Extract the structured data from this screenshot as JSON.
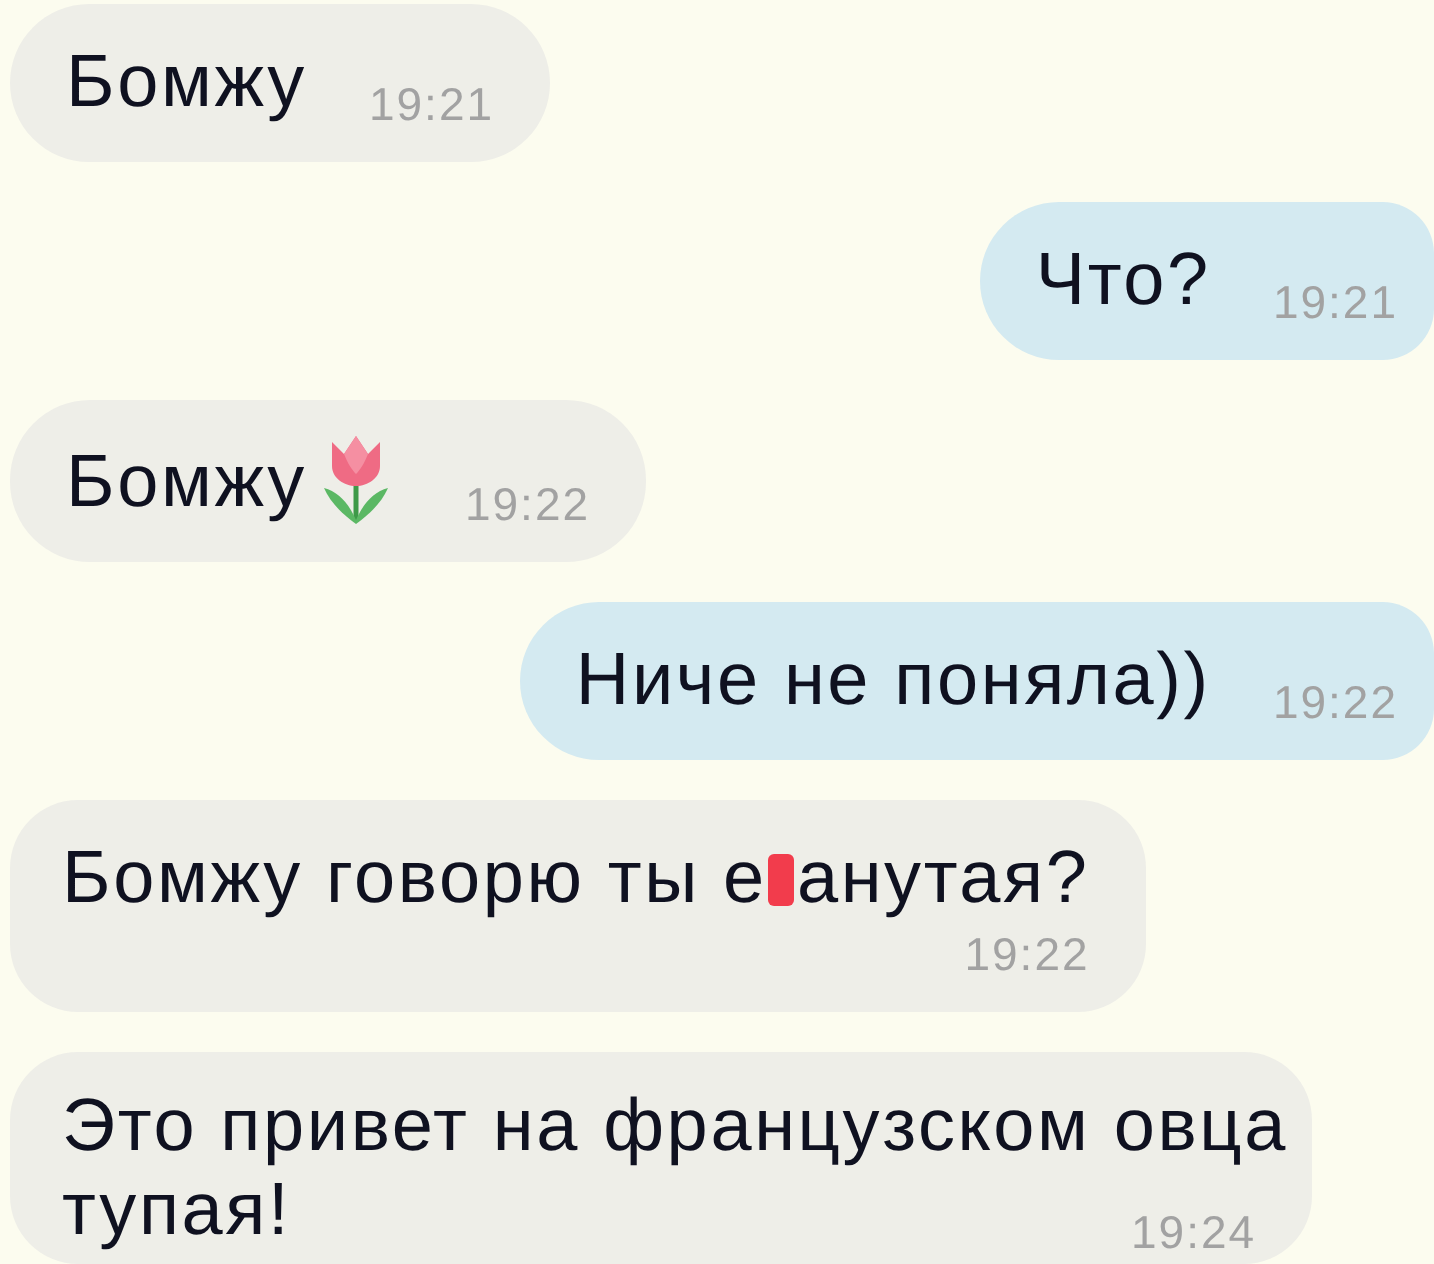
{
  "messages": [
    {
      "outgoing": false,
      "kind": "inline",
      "segments": [
        {
          "kind": "text",
          "text": "Бомжу"
        }
      ],
      "time": "19:21"
    },
    {
      "outgoing": true,
      "kind": "inline",
      "segments": [
        {
          "kind": "text",
          "text": "Что?"
        }
      ],
      "time": "19:21"
    },
    {
      "outgoing": false,
      "kind": "inline",
      "segments": [
        {
          "kind": "text",
          "text": "Бомжу"
        },
        {
          "kind": "emoji"
        }
      ],
      "time": "19:22"
    },
    {
      "outgoing": true,
      "kind": "inline",
      "segments": [
        {
          "kind": "text",
          "text": "Ниче не поняла))"
        }
      ],
      "time": "19:22"
    },
    {
      "outgoing": false,
      "kind": "stacked",
      "segments": [
        {
          "kind": "text",
          "text": "Бомжу говорю ты е"
        },
        {
          "kind": "censor"
        },
        {
          "kind": "text",
          "text": "анутая?"
        }
      ],
      "time": "19:22"
    },
    {
      "outgoing": false,
      "kind": "wrapped",
      "segments": [
        {
          "kind": "text",
          "text": "Это привет на французском овца"
        },
        {
          "kind": "text",
          "text": "тупая!"
        }
      ],
      "time": "19:24"
    }
  ]
}
